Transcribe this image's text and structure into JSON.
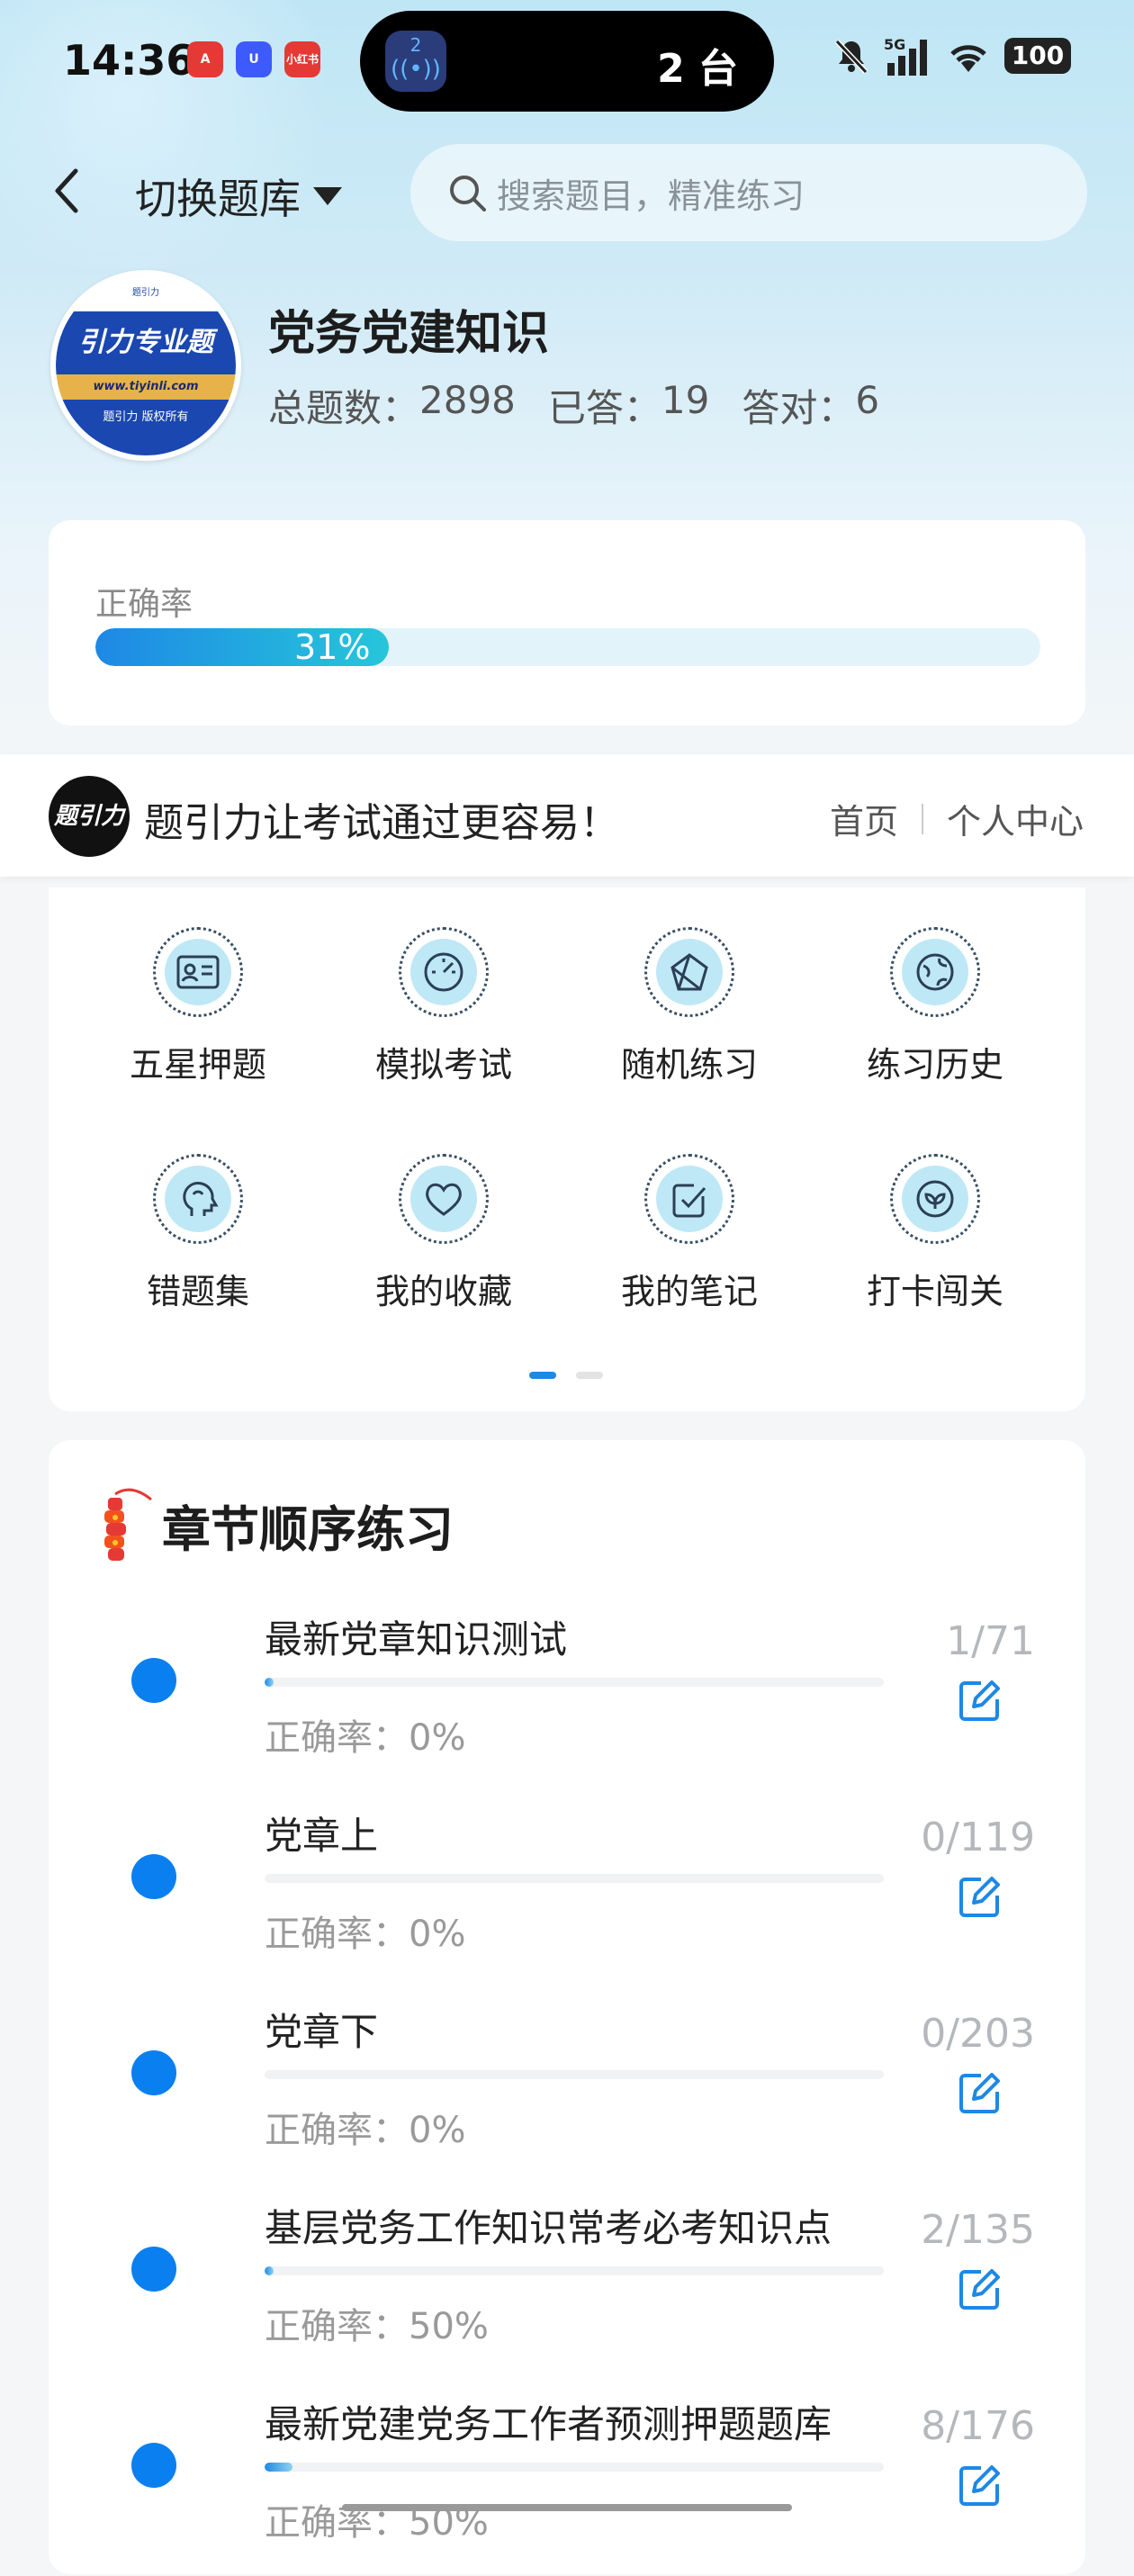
{
  "status_bar": {
    "time": "14:36",
    "island_badge": "2",
    "island_text": "2 台",
    "signal": "5G",
    "battery": "100",
    "apps": [
      "app-a",
      "app-u",
      "小红书"
    ]
  },
  "nav": {
    "switch_label": "切换题库",
    "search_placeholder": "搜索题目，精准练习"
  },
  "bank": {
    "logo_brand": "引力专业题",
    "logo_url": "www.tiyinli.com",
    "logo_copyright": "题引力 版权所有",
    "logo_top": "题引力",
    "title": "党务党建知识",
    "total_label": "总题数：",
    "total": "2898",
    "answered_label": "已答：",
    "answered": "19",
    "correct_label": "答对：",
    "correct": "6"
  },
  "accuracy": {
    "label": "正确率",
    "value_text": "31%",
    "value": 0.31
  },
  "ad": {
    "logo_text": "题引力",
    "slogan": "题引力让考试通过更容易！",
    "nav": [
      "首页",
      "个人中心"
    ]
  },
  "features": [
    {
      "label": "五星押题",
      "icon": "id-card-icon"
    },
    {
      "label": "模拟考试",
      "icon": "speedometer-icon"
    },
    {
      "label": "随机练习",
      "icon": "shapes-icon"
    },
    {
      "label": "练习历史",
      "icon": "globe-icon"
    },
    {
      "label": "错题集",
      "icon": "head-icon"
    },
    {
      "label": "我的收藏",
      "icon": "heart-icon"
    },
    {
      "label": "我的笔记",
      "icon": "note-check-icon"
    },
    {
      "label": "打卡闯关",
      "icon": "leaf-icon"
    }
  ],
  "pager": {
    "pages": 2,
    "active": 0
  },
  "chapters": {
    "title": "章节顺序练习",
    "items": [
      {
        "name": "最新党章知识测试",
        "accuracy": "正确率：0%",
        "count": "1/71",
        "progress": 0.014
      },
      {
        "name": "党章上",
        "accuracy": "正确率：0%",
        "count": "0/119",
        "progress": 0
      },
      {
        "name": "党章下",
        "accuracy": "正确率：0%",
        "count": "0/203",
        "progress": 0
      },
      {
        "name": "基层党务工作知识常考必考知识点",
        "accuracy": "正确率：50%",
        "count": "2/135",
        "progress": 0.015
      },
      {
        "name": "最新党建党务工作者预测押题题库",
        "accuracy": "正确率：50%",
        "count": "8/176",
        "progress": 0.045
      }
    ]
  }
}
